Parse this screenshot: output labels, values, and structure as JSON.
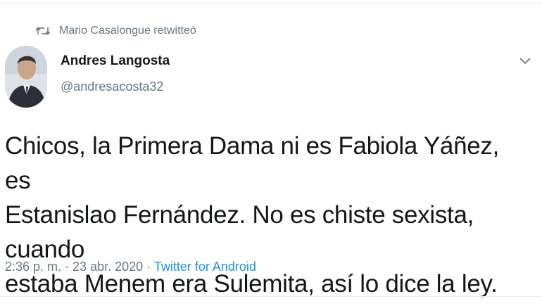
{
  "retweet": {
    "icon": "retweet-icon",
    "text": "Mario Casalongue retwitteó"
  },
  "author": {
    "avatar": "avatar",
    "name": "Andres Langosta",
    "handle": "@andresacosta32"
  },
  "menu": {
    "icon": "chevron-down-icon"
  },
  "tweet": {
    "lines": [
      "Chicos, la Primera Dama ni es Fabiola Yáñez, es",
      "Estanislao Fernández. No es chiste sexista, cuando",
      "estaba Menem era Sulemita, así lo dice la ley."
    ]
  },
  "meta": {
    "time": "2:36 p. m.",
    "separator": " · ",
    "date": "23 abr. 2020",
    "separator2": " · ",
    "source": "Twitter for Android"
  },
  "colors": {
    "text": "#14171a",
    "muted": "#657786",
    "link": "#1b95e0",
    "divider": "#e6ecf0"
  }
}
